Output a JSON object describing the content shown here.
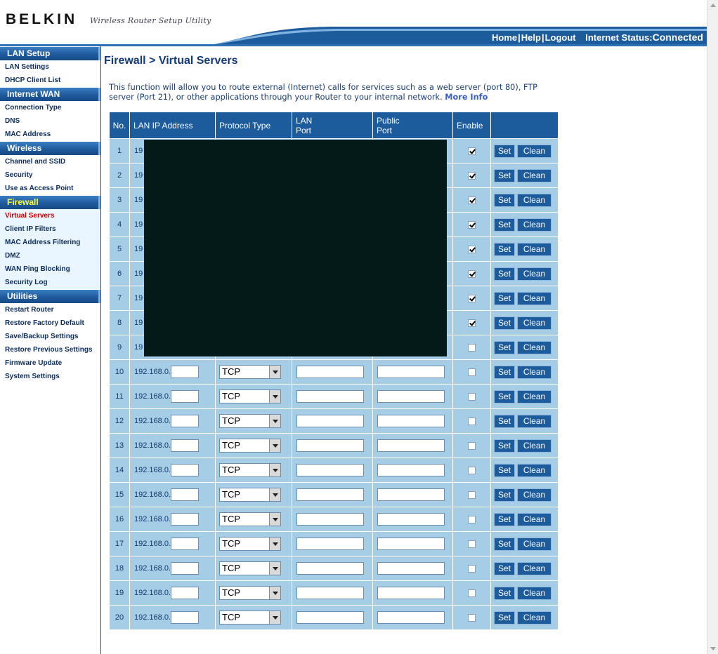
{
  "header": {
    "brand": "BELKIN",
    "tagline": "Wireless Router Setup Utility",
    "links": {
      "home": "Home",
      "help": "Help",
      "logout": "Logout"
    },
    "separator": "|",
    "status_label": "Internet Status:",
    "status_value": "Connected",
    "colors": {
      "bar": "#1c5b9c",
      "status": "#44ff44"
    }
  },
  "sidebar": {
    "sections": [
      {
        "title": "LAN Setup",
        "items": [
          "LAN Settings",
          "DHCP Client List"
        ]
      },
      {
        "title": "Internet WAN",
        "items": [
          "Connection Type",
          "DNS",
          "MAC Address"
        ]
      },
      {
        "title": "Wireless",
        "items": [
          "Channel and SSID",
          "Security",
          "Use as Access Point"
        ]
      },
      {
        "title": "Firewall",
        "items": [
          "Virtual Servers",
          "Client IP Filters",
          "MAC Address Filtering",
          "DMZ",
          "WAN Ping Blocking",
          "Security Log"
        ]
      },
      {
        "title": "Utilities",
        "items": [
          "Restart Router",
          "Restore Factory Default",
          "Save/Backup Settings",
          "Restore Previous Settings",
          "Firmware Update",
          "System Settings"
        ]
      }
    ],
    "active_section": "Firewall",
    "current_item": "Virtual Servers"
  },
  "main": {
    "title": "Firewall > Virtual Servers",
    "intro": "This function will allow you to route external (Internet) calls for services such as a web server (port 80), FTP server (Port 21), or other applications through your Router to your internal network.",
    "more_info": "More Info"
  },
  "table": {
    "headers": {
      "no": "No.",
      "ip": "LAN IP Address",
      "protocol": "Protocol Type",
      "lan_port_1": "LAN",
      "lan_port_2": "Port",
      "public_port_1": "Public",
      "public_port_2": "Port",
      "enable": "Enable"
    },
    "ip_prefix": "192.168.0.",
    "ip_prefix_redacted": "19",
    "protocol_default": "TCP",
    "set_label": "Set",
    "clean_label": "Clean",
    "rows": [
      {
        "no": "1",
        "enabled": true,
        "redacted": true
      },
      {
        "no": "2",
        "enabled": true,
        "redacted": true
      },
      {
        "no": "3",
        "enabled": true,
        "redacted": true
      },
      {
        "no": "4",
        "enabled": true,
        "redacted": true
      },
      {
        "no": "5",
        "enabled": true,
        "redacted": true
      },
      {
        "no": "6",
        "enabled": true,
        "redacted": true
      },
      {
        "no": "7",
        "enabled": true,
        "redacted": true
      },
      {
        "no": "8",
        "enabled": true,
        "redacted": true
      },
      {
        "no": "9",
        "enabled": false,
        "redacted": true
      },
      {
        "no": "10",
        "enabled": false,
        "redacted": false
      },
      {
        "no": "11",
        "enabled": false,
        "redacted": false
      },
      {
        "no": "12",
        "enabled": false,
        "redacted": false
      },
      {
        "no": "13",
        "enabled": false,
        "redacted": false
      },
      {
        "no": "14",
        "enabled": false,
        "redacted": false
      },
      {
        "no": "15",
        "enabled": false,
        "redacted": false
      },
      {
        "no": "16",
        "enabled": false,
        "redacted": false
      },
      {
        "no": "17",
        "enabled": false,
        "redacted": false
      },
      {
        "no": "18",
        "enabled": false,
        "redacted": false
      },
      {
        "no": "19",
        "enabled": false,
        "redacted": false
      },
      {
        "no": "20",
        "enabled": false,
        "redacted": false
      }
    ]
  }
}
